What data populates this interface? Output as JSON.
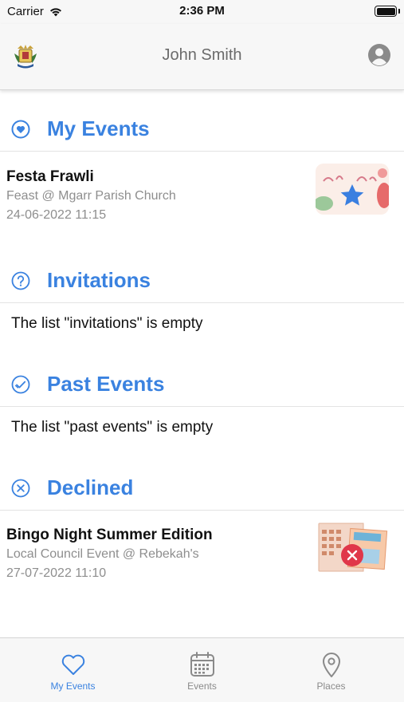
{
  "status_bar": {
    "carrier": "Carrier",
    "time": "2:36 PM",
    "battery_level": 1.0
  },
  "header": {
    "title": "John Smith",
    "logo_icon": "crest-icon",
    "profile_icon": "user-circle-icon"
  },
  "sections": {
    "my_events": {
      "title": "My Events",
      "icon": "heart-circle-icon",
      "events": [
        {
          "name": "Festa Frawli",
          "subtitle": "Feast @ Mgarr Parish Church",
          "date": "24-06-2022 11:15",
          "badge_icon": "star-icon"
        }
      ]
    },
    "invitations": {
      "title": "Invitations",
      "icon": "question-circle-icon",
      "empty_text": "The list \"invitations\" is empty"
    },
    "past_events": {
      "title": "Past Events",
      "icon": "check-circle-icon",
      "empty_text": "The list \"past events\" is empty"
    },
    "declined": {
      "title": "Declined",
      "icon": "x-circle-icon",
      "events": [
        {
          "name": "Bingo Night Summer Edition",
          "subtitle": "Local Council Event @ Rebekah's",
          "date": "27-07-2022 11:10",
          "badge_icon": "x-badge-icon"
        }
      ]
    }
  },
  "tab_bar": {
    "tabs": [
      {
        "label": "My Events",
        "icon": "heart-icon",
        "active": true
      },
      {
        "label": "Events",
        "icon": "calendar-icon",
        "active": false
      },
      {
        "label": "Places",
        "icon": "location-pin-icon",
        "active": false
      }
    ]
  },
  "colors": {
    "accent": "#3a82e0",
    "muted_text": "#8e8e8e",
    "declined_badge": "#e0374a",
    "star_badge": "#3a7fe0"
  }
}
